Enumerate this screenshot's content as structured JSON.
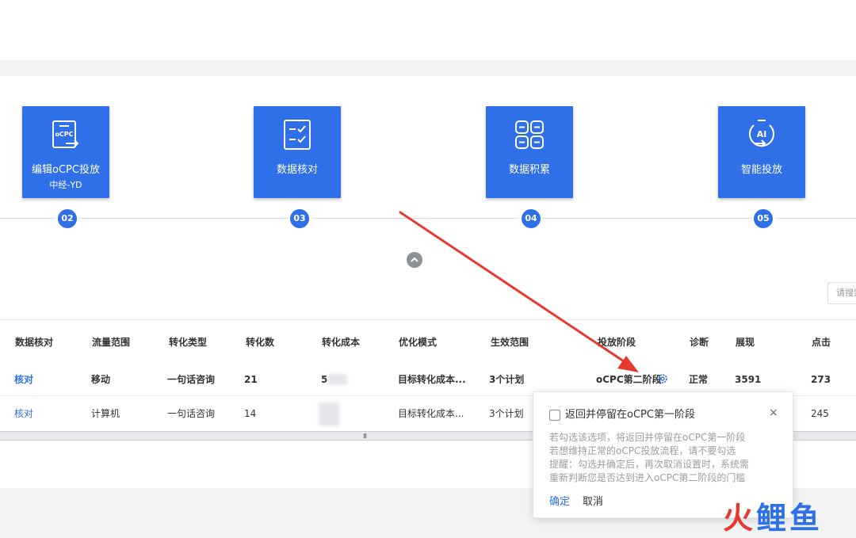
{
  "steps": [
    {
      "title": "编辑oCPC投放",
      "subtitle": "中经-YD",
      "number": "02",
      "icon": "ocpc-edit-icon",
      "icon_text": "oCPC"
    },
    {
      "title": "数据核对",
      "number": "03",
      "icon": "checklist-icon"
    },
    {
      "title": "数据积累",
      "number": "04",
      "icon": "grid-icon"
    },
    {
      "title": "智能投放",
      "number": "05",
      "icon": "ai-icon",
      "icon_text": "AI"
    }
  ],
  "search": {
    "placeholder": "请搜索"
  },
  "table": {
    "headers": [
      "数据核对",
      "流量范围",
      "转化类型",
      "转化数",
      "转化成本",
      "优化模式",
      "生效范围",
      "投放阶段",
      "诊断",
      "展现",
      "点击"
    ],
    "rows": [
      {
        "check": "核对",
        "traffic": "移动",
        "conv_type": "一句话咨询",
        "conv_count": "21",
        "conv_cost": "5",
        "mode": "目标转化成本...",
        "scope": "3个计划",
        "stage": "oCPC第二阶段",
        "diagnosis": "正常",
        "impressions": "3591",
        "clicks": "273"
      },
      {
        "check": "核对",
        "traffic": "计算机",
        "conv_type": "一句话咨询",
        "conv_count": "14",
        "conv_cost": "",
        "mode": "目标转化成本...",
        "scope": "3个计划",
        "stage": "",
        "diagnosis": "",
        "impressions": "",
        "clicks": "245"
      }
    ]
  },
  "popover": {
    "checkbox_label": "返回并停留在oCPC第一阶段",
    "close": "×",
    "desc": [
      "若勾选该选项，将返回并停留在oCPC第一阶段",
      "若想维持正常的oCPC投放流程，请不要勾选",
      "提醒：勾选并确定后，再次取消设置时，系统需",
      "重新判断您是否达到进入oCPC第二阶段的门槛"
    ],
    "confirm": "确定",
    "cancel": "取消"
  },
  "scroll_grip": "III",
  "watermark": {
    "part1": "火",
    "part2": "鲤鱼"
  },
  "colors": {
    "primary": "#2f6fe8",
    "arrow": "#e8392f",
    "watermark_red": "#e8392f",
    "watermark_blue": "#2f6fe8"
  }
}
